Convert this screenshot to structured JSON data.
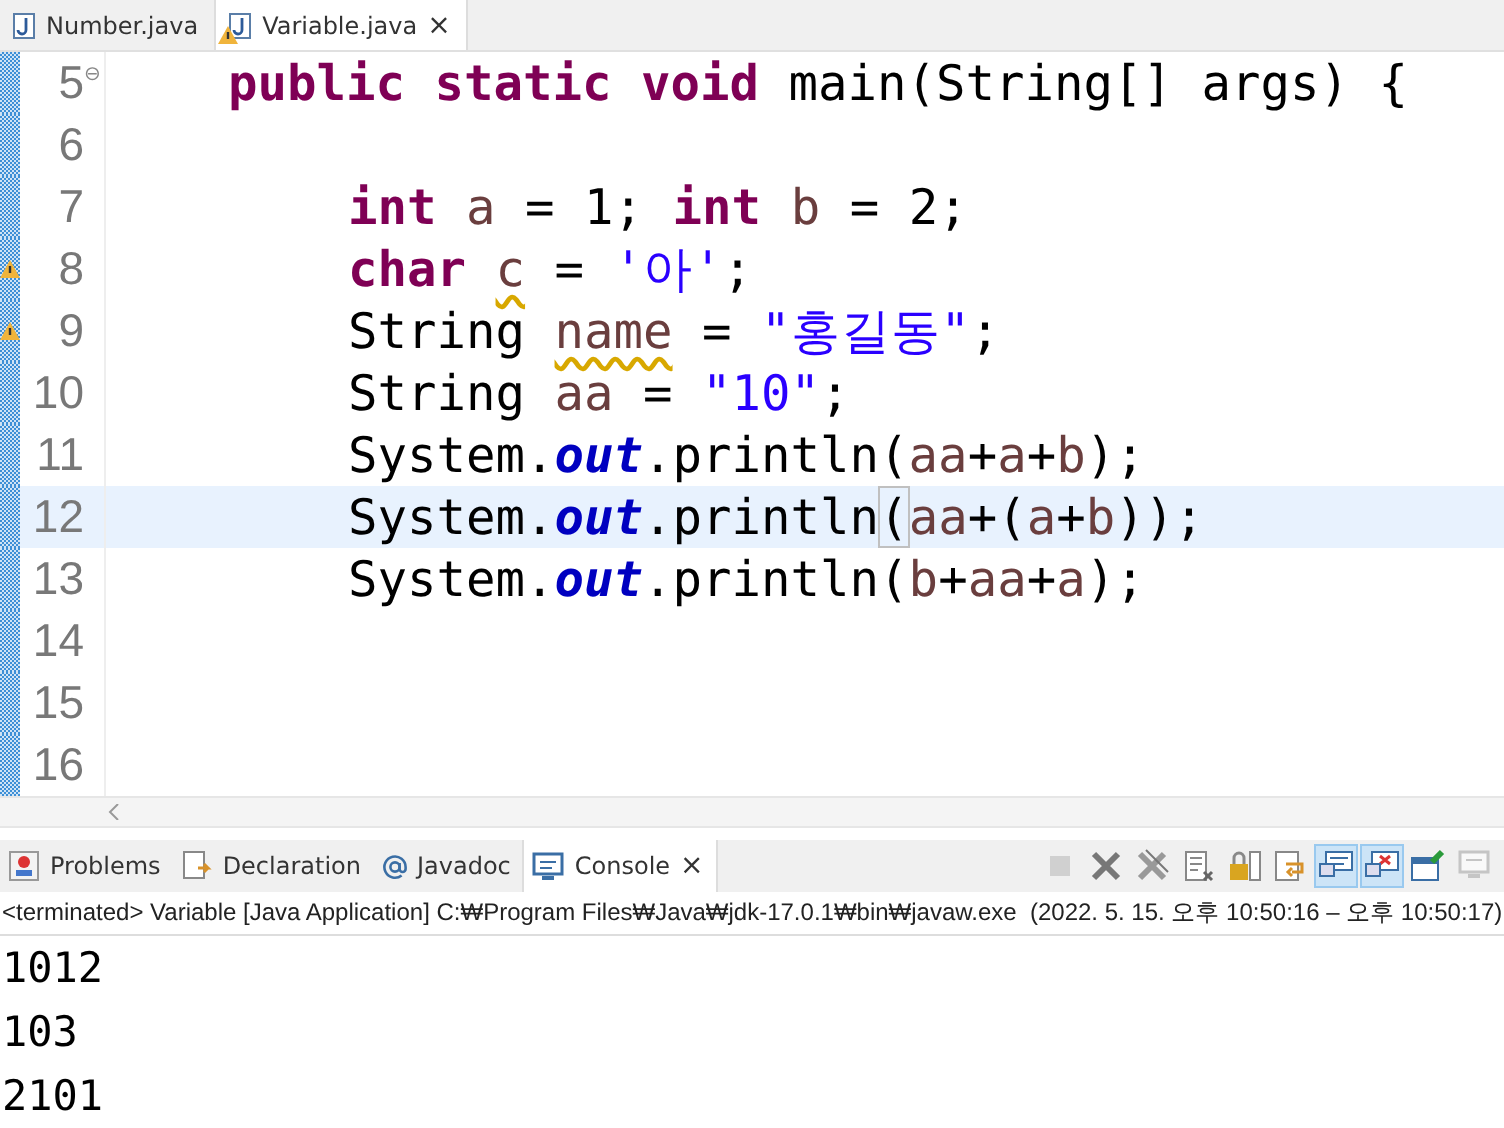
{
  "editor_tabs": [
    {
      "label": "Number.java",
      "selected": false,
      "warning": false
    },
    {
      "label": "Variable.java",
      "selected": true,
      "warning": true,
      "close": "×"
    }
  ],
  "code_lines": [
    {
      "number": "5",
      "fold_marker": "⊖",
      "kind": "method",
      "warning": false,
      "current": false,
      "tokens": [
        {
          "text": "public",
          "kind": "keyword"
        },
        {
          "text": " static",
          "kind": "keyword"
        },
        {
          "text": " void",
          "kind": "keyword"
        },
        {
          "text": " main(String[] args) {",
          "kind": "plain"
        }
      ]
    },
    {
      "number": "6",
      "warning": false,
      "current": false
    },
    {
      "number": "7",
      "kind": "statement",
      "warning": false,
      "current": false,
      "tokens": [
        {
          "text": "int",
          "kind": "keyword"
        },
        {
          "text": " a",
          "kind": "variable"
        },
        {
          "text": " = 1; ",
          "kind": "plain"
        },
        {
          "text": "int",
          "kind": "keyword"
        },
        {
          "text": " b",
          "kind": "variable"
        },
        {
          "text": " = 2;",
          "kind": "plain"
        }
      ]
    },
    {
      "number": "8",
      "kind": "statement",
      "warning": true,
      "current": false,
      "tokens": [
        {
          "text": "char ",
          "kind": "keyword"
        },
        {
          "text": "c",
          "kind": "unused"
        },
        {
          "text": " = ",
          "kind": "plain"
        },
        {
          "text": "'아'",
          "kind": "string"
        },
        {
          "text": ";",
          "kind": "plain"
        }
      ]
    },
    {
      "number": "9",
      "kind": "statement",
      "warning": true,
      "current": false,
      "tokens": [
        {
          "text": "String ",
          "kind": "plain"
        },
        {
          "text": "name",
          "kind": "unused"
        },
        {
          "text": " = ",
          "kind": "plain"
        },
        {
          "text": "\"홍길동\"",
          "kind": "string"
        },
        {
          "text": ";",
          "kind": "plain"
        }
      ]
    },
    {
      "number": "10",
      "kind": "statement",
      "warning": false,
      "current": false,
      "tokens": [
        {
          "text": "String ",
          "kind": "plain"
        },
        {
          "text": "aa",
          "kind": "variable"
        },
        {
          "text": " = ",
          "kind": "plain"
        },
        {
          "text": "\"10\"",
          "kind": "string"
        },
        {
          "text": ";",
          "kind": "plain"
        }
      ]
    },
    {
      "number": "11",
      "kind": "statement",
      "warning": false,
      "current": false,
      "tokens": [
        {
          "text": "System.",
          "kind": "plain"
        },
        {
          "text": "out",
          "kind": "field"
        },
        {
          "text": ".println(",
          "kind": "plain"
        },
        {
          "text": "aa",
          "kind": "variable"
        },
        {
          "text": "+",
          "kind": "plain"
        },
        {
          "text": "a",
          "kind": "variable"
        },
        {
          "text": "+",
          "kind": "plain"
        },
        {
          "text": "b",
          "kind": "variable"
        },
        {
          "text": ");",
          "kind": "plain"
        }
      ]
    },
    {
      "number": "12",
      "kind": "statement",
      "warning": false,
      "current": true,
      "tokens": [
        {
          "text": "System.",
          "kind": "plain"
        },
        {
          "text": "out",
          "kind": "field"
        },
        {
          "text": ".println",
          "kind": "plain"
        },
        {
          "text": "(",
          "kind": "bracket"
        },
        {
          "text": "aa",
          "kind": "variable"
        },
        {
          "text": "+(",
          "kind": "plain"
        },
        {
          "text": "a",
          "kind": "variable"
        },
        {
          "text": "+",
          "kind": "plain"
        },
        {
          "text": "b",
          "kind": "variable"
        },
        {
          "text": "));",
          "kind": "plain"
        }
      ]
    },
    {
      "number": "13",
      "kind": "statement",
      "warning": false,
      "current": false,
      "tokens": [
        {
          "text": "System.",
          "kind": "plain"
        },
        {
          "text": "out",
          "kind": "field"
        },
        {
          "text": ".println(",
          "kind": "plain"
        },
        {
          "text": "b",
          "kind": "variable"
        },
        {
          "text": "+",
          "kind": "plain"
        },
        {
          "text": "aa",
          "kind": "variable"
        },
        {
          "text": "+",
          "kind": "plain"
        },
        {
          "text": "a",
          "kind": "variable"
        },
        {
          "text": ");",
          "kind": "plain"
        }
      ]
    },
    {
      "number": "14",
      "warning": false,
      "current": false
    },
    {
      "number": "15",
      "warning": false,
      "current": false
    },
    {
      "number": "16",
      "warning": false,
      "current": false
    }
  ],
  "panel_tabs": [
    {
      "label": "Problems",
      "selected": false
    },
    {
      "label": "Declaration",
      "selected": false
    },
    {
      "label": "Javadoc",
      "selected": false
    },
    {
      "label": "Console",
      "selected": true,
      "close": "×"
    }
  ],
  "console_toolbar": [
    {
      "selected": false,
      "disabled": true
    },
    {
      "selected": false,
      "disabled": false
    },
    {
      "selected": false,
      "disabled": false
    },
    {
      "selected": false,
      "disabled": false
    },
    {
      "selected": false,
      "disabled": false
    },
    {
      "selected": false,
      "disabled": false
    },
    {
      "selected": true,
      "disabled": false
    },
    {
      "selected": true,
      "disabled": false
    },
    {
      "selected": false,
      "disabled": false
    },
    {
      "selected": false,
      "disabled": true
    }
  ],
  "console_status": "<terminated> Variable [Java Application] C:₩Program Files₩Java₩jdk-17.0.1₩bin₩javaw.exe  (2022. 5. 15. 오후 10:50:16 – 오후 10:50:17)",
  "console_output": [
    "1012",
    "103",
    "2101"
  ]
}
